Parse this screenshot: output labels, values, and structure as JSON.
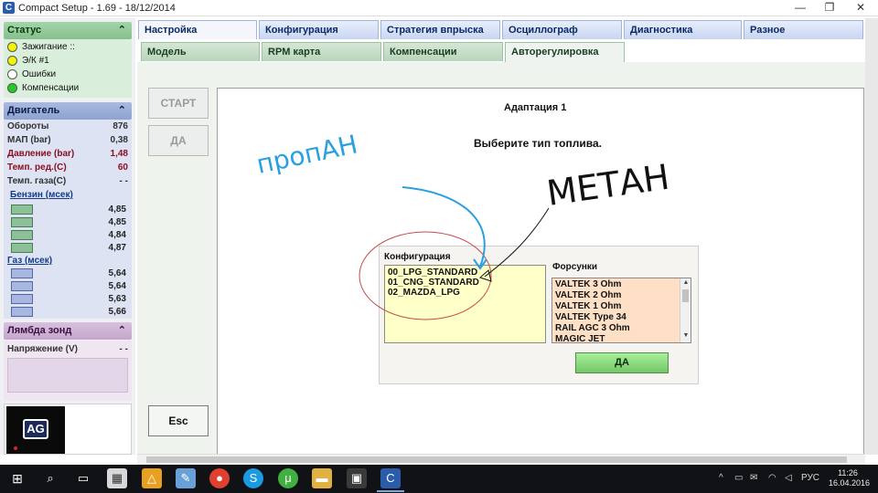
{
  "window": {
    "title": "Compact Setup - 1.69 - 18/12/2014",
    "app_icon": "C",
    "minimize": "—",
    "maximize": "❐",
    "close": "✕"
  },
  "status": {
    "header": "Статус",
    "items": [
      {
        "label": "Зажигание ::",
        "color": "#f2f20a"
      },
      {
        "label": "Э/К #1",
        "color": "#f2f20a"
      },
      {
        "label": "Ошибки",
        "color": "#ffffff"
      },
      {
        "label": "Компенсации",
        "color": "#22cc22"
      }
    ]
  },
  "engine": {
    "header": "Двигатель",
    "rows": [
      {
        "label": "Обороты",
        "value": "876"
      },
      {
        "label": "МАП (bar)",
        "value": "0,38"
      },
      {
        "label": "Давление (bar)",
        "value": "1,48"
      },
      {
        "label": "Темп. ред.(C)",
        "value": "60"
      },
      {
        "label": "Темп. газа(C)",
        "value": "- -"
      }
    ],
    "petrol_title": "Бензин (мсек)",
    "petrol": [
      "4,85",
      "4,85",
      "4,84",
      "4,87"
    ],
    "gas_title": "Газ (мсек)",
    "gas": [
      "5,64",
      "5,64",
      "5,63",
      "5,66"
    ]
  },
  "lambda": {
    "header": "Лямбда зонд",
    "voltage_label": "Напряжение (V)",
    "voltage_value": "- -"
  },
  "logo": {
    "text": "AG"
  },
  "tabs_row1": [
    "Настройка",
    "Конфигурация",
    "Стратегия впрыска",
    "Осциллограф",
    "Диагностика",
    "Разное"
  ],
  "tabs_row2": [
    "Модель",
    "RPM карта",
    "Компенсации",
    "Авторегулировка"
  ],
  "buttons": {
    "start": "СТАРТ",
    "yes": "ДА",
    "esc": "Esc",
    "dialog_yes": "ДА"
  },
  "adaptation": {
    "title": "Адаптация 1",
    "prompt": "Выберите тип топлива."
  },
  "config": {
    "label": "Конфигурация",
    "items": [
      "00_LPG_STANDARD",
      "01_CNG_STANDARD",
      "02_MAZDA_LPG"
    ]
  },
  "injectors": {
    "label": "Форсунки",
    "items": [
      "VALTEK 3 Ohm",
      "VALTEK 2 Ohm",
      "VALTEK 1 Ohm",
      "VALTEK Type 34",
      "RAIL AGC 3 Ohm",
      "MAGIC JET"
    ]
  },
  "annotations": {
    "propane": "пропАН",
    "methane": "МЕТАН"
  },
  "taskbar": {
    "tray_lang": "РУС",
    "time": "11:26",
    "date": "16.04.2016"
  }
}
